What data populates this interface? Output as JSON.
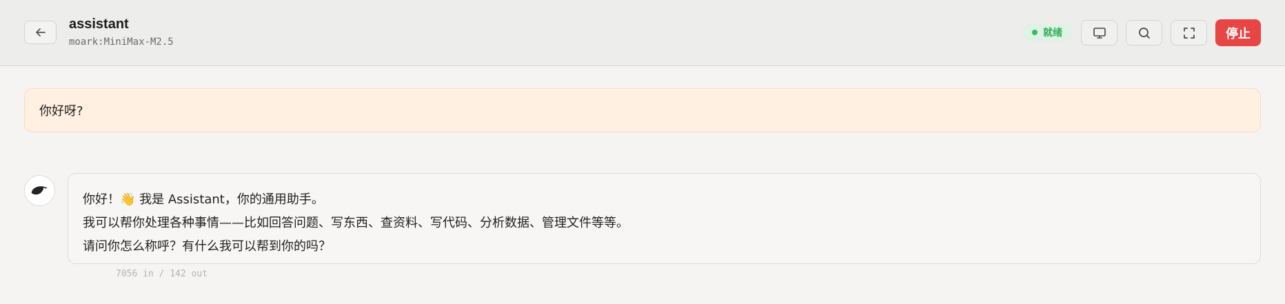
{
  "header": {
    "title": "assistant",
    "model": "moark:MiniMax-M2.5",
    "status": "就绪",
    "stop_label": "停止",
    "icons": [
      "arrow-left-icon",
      "monitor-icon",
      "search-icon",
      "fullscreen-icon"
    ],
    "colors": {
      "status": "#2fae55",
      "stop": "#e84545"
    }
  },
  "messages": {
    "user": {
      "text": "你好呀?"
    },
    "assistant": {
      "line1_prefix": "你好！",
      "wave_emoji": "👋",
      "line1_suffix": " 我是 Assistant，你的通用助手。",
      "line2": "我可以帮你处理各种事情——比如回答问题、写东西、查资料、写代码、分析数据、管理文件等等。",
      "line3": "请问你怎么称呼？有什么我可以帮到你的吗？",
      "tokens": "7056 in / 142 out"
    }
  }
}
